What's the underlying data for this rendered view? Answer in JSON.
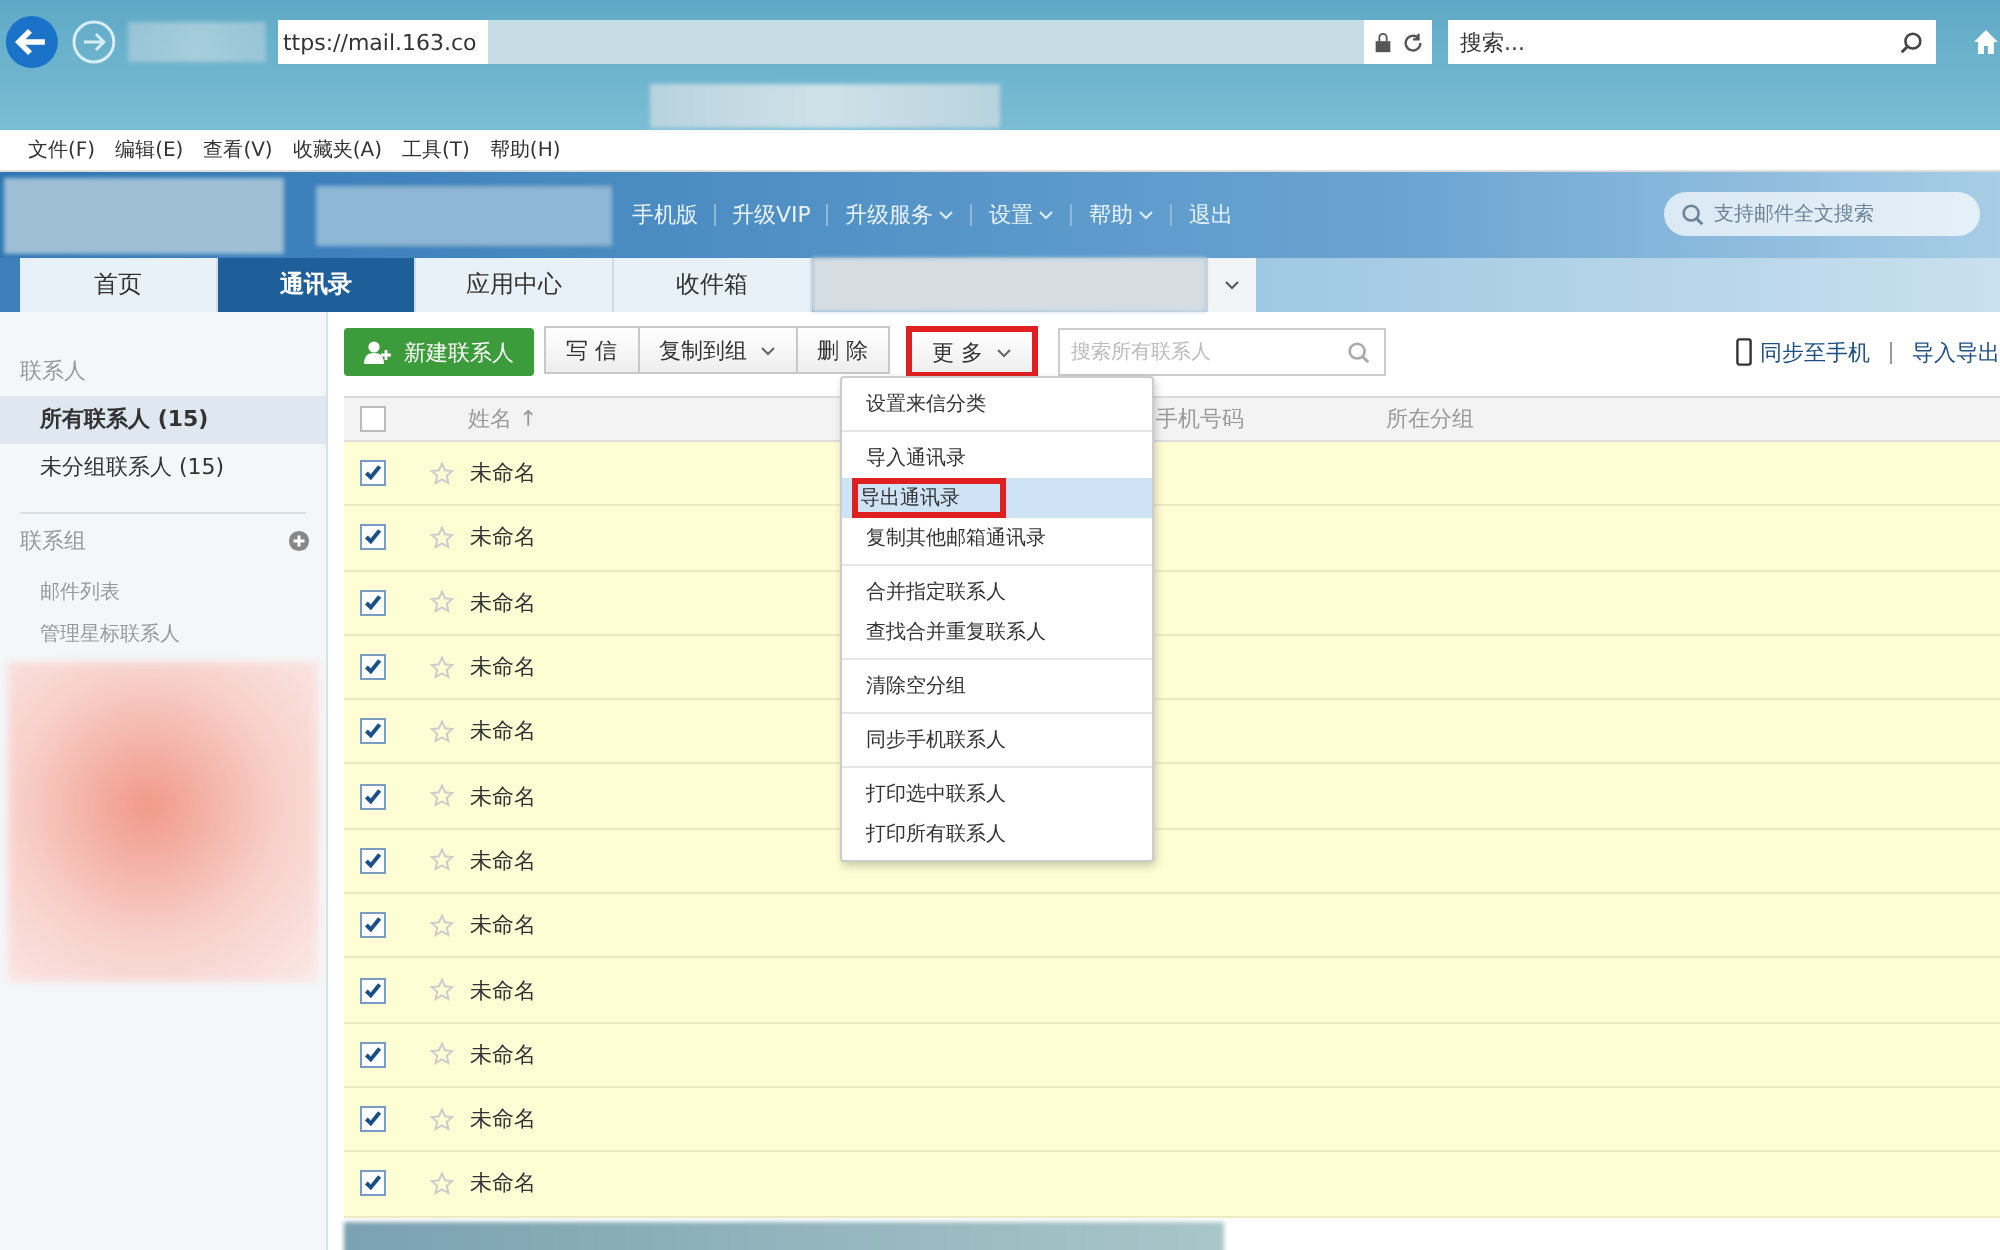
{
  "browser": {
    "url": "ttps://mail.163.co",
    "search_placeholder": "搜索..."
  },
  "menu_bar": [
    "文件(F)",
    "编辑(E)",
    "查看(V)",
    "收藏夹(A)",
    "工具(T)",
    "帮助(H)"
  ],
  "header": {
    "links": [
      {
        "label": "手机版",
        "has_menu": false
      },
      {
        "label": "升级VIP",
        "has_menu": false
      },
      {
        "label": "升级服务",
        "has_menu": true
      },
      {
        "label": "设置",
        "has_menu": true
      },
      {
        "label": "帮助",
        "has_menu": true
      },
      {
        "label": "退出",
        "has_menu": false
      }
    ],
    "search_placeholder": "支持邮件全文搜索"
  },
  "tabs": [
    {
      "label": "首页",
      "selected": false
    },
    {
      "label": "通讯录",
      "selected": true
    },
    {
      "label": "应用中心",
      "selected": false
    },
    {
      "label": "收件箱",
      "selected": false
    }
  ],
  "sidebar": {
    "contacts_heading": "联系人",
    "items": [
      {
        "label": "所有联系人 (15)",
        "selected": true
      },
      {
        "label": "未分组联系人 (15)",
        "selected": false
      }
    ],
    "groups_heading": "联系组",
    "group_items": [
      "邮件列表",
      "管理星标联系人"
    ]
  },
  "toolbar": {
    "new_contact": "新建联系人",
    "buttons": [
      {
        "label": "写 信",
        "has_menu": false,
        "highlighted": false
      },
      {
        "label": "复制到组",
        "has_menu": true,
        "highlighted": false
      },
      {
        "label": "删 除",
        "has_menu": false,
        "highlighted": false
      },
      {
        "label": "更 多",
        "has_menu": true,
        "highlighted": true
      }
    ],
    "search_placeholder": "搜索所有联系人",
    "sync_link": "同步至手机",
    "import_export_link": "导入导出"
  },
  "table": {
    "columns": [
      "姓名 ↑",
      "手机号码",
      "所在分组"
    ],
    "rows": [
      {
        "name": "未命名",
        "checked": true,
        "starred": false
      },
      {
        "name": "未命名",
        "checked": true,
        "starred": false
      },
      {
        "name": "未命名",
        "checked": true,
        "starred": false
      },
      {
        "name": "未命名",
        "checked": true,
        "starred": false
      },
      {
        "name": "未命名",
        "checked": true,
        "starred": false
      },
      {
        "name": "未命名",
        "checked": true,
        "starred": false
      },
      {
        "name": "未命名",
        "checked": true,
        "starred": false
      },
      {
        "name": "未命名",
        "checked": true,
        "starred": false
      },
      {
        "name": "未命名",
        "checked": true,
        "starred": false
      },
      {
        "name": "未命名",
        "checked": true,
        "starred": false
      },
      {
        "name": "未命名",
        "checked": true,
        "starred": false
      },
      {
        "name": "未命名",
        "checked": true,
        "starred": false
      }
    ],
    "header_checked": false
  },
  "more_menu": [
    [
      {
        "label": "设置来信分类",
        "selected": false,
        "highlighted": false
      }
    ],
    [
      {
        "label": "导入通讯录",
        "selected": false,
        "highlighted": false
      },
      {
        "label": "导出通讯录",
        "selected": true,
        "highlighted": true
      },
      {
        "label": "复制其他邮箱通讯录",
        "selected": false,
        "highlighted": false
      }
    ],
    [
      {
        "label": "合并指定联系人",
        "selected": false,
        "highlighted": false
      },
      {
        "label": "查找合并重复联系人",
        "selected": false,
        "highlighted": false
      }
    ],
    [
      {
        "label": "清除空分组",
        "selected": false,
        "highlighted": false
      }
    ],
    [
      {
        "label": "同步手机联系人",
        "selected": false,
        "highlighted": false
      }
    ],
    [
      {
        "label": "打印选中联系人",
        "selected": false,
        "highlighted": false
      },
      {
        "label": "打印所有联系人",
        "selected": false,
        "highlighted": false
      }
    ]
  ]
}
